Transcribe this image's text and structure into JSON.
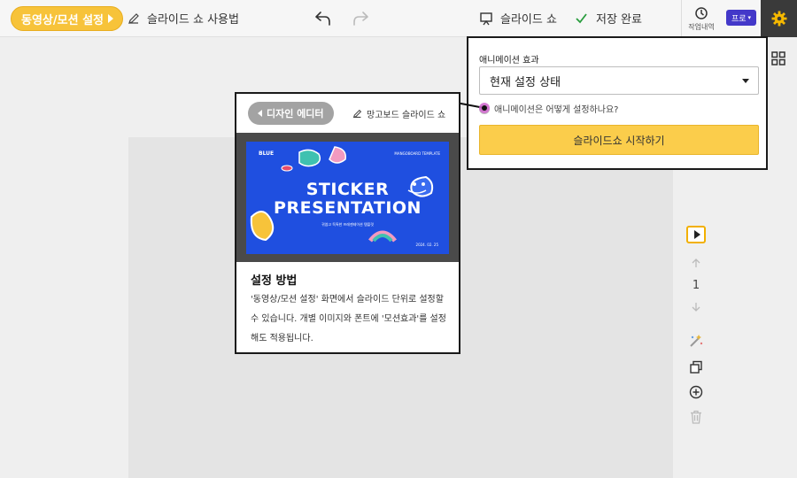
{
  "toolbar": {
    "video_motion_label": "동영상/모션 설정",
    "howto_label": "슬라이드 쇼 사용법",
    "slideshow_label": "슬라이드 쇼",
    "saved_label": "저장 완료",
    "history_label": "작업내역",
    "pro_label": "프로"
  },
  "popup": {
    "animation_label": "애니메이션 효과",
    "select_value": "현재 설정 상태",
    "help_text": "애니메이션은 어떻게 설정하나요?",
    "help_mark": "?",
    "start_button": "슬라이드쇼 시작하기"
  },
  "card": {
    "design_editor_button": "디자인 에디터",
    "mango_link": "망고보드 슬라이드 쇼",
    "thumbnail": {
      "logo": "BLUE",
      "tag": "MANGOBOARD TEMPLATE",
      "title_line1": "STICKER",
      "title_line2": "PRESENTATION",
      "subtitle": "귀엽고 독특한 프레젠테이션 템플릿",
      "date": "2024. 02. 25"
    },
    "title": "설정 방법",
    "body": "'동영상/모션 설정' 화면에서 슬라이드 단위로 설정할 수 있습니다. 개별 이미지와 폰트에 '모션효과'를 설정해도 적용됩니다."
  },
  "side": {
    "page_number": "1"
  },
  "colors": {
    "accent_yellow": "#f7c33a",
    "thumbnail_blue": "#1f4fe0",
    "pro_purple": "#4338c9"
  }
}
